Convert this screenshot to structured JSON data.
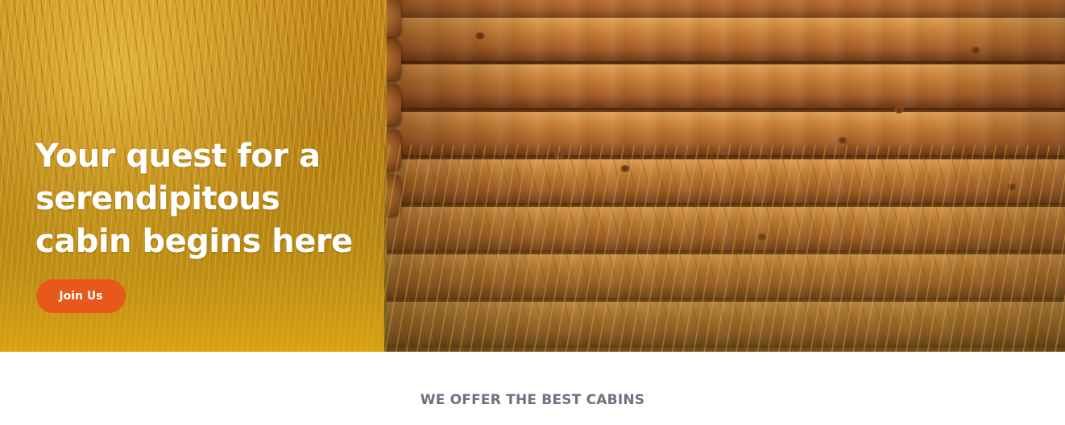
{
  "hero": {
    "headline": "Your quest for a serendipitous cabin begins here",
    "cta_label": "Join Us",
    "image": "cabin-wall-and-golden-grass",
    "colors": {
      "cta_background": "#e8581a",
      "overlay": "#ecaf12",
      "headline_text": "#ffffff"
    }
  },
  "offer": {
    "title": "WE OFFER THE BEST CABINS",
    "title_color": "#6b7280"
  }
}
